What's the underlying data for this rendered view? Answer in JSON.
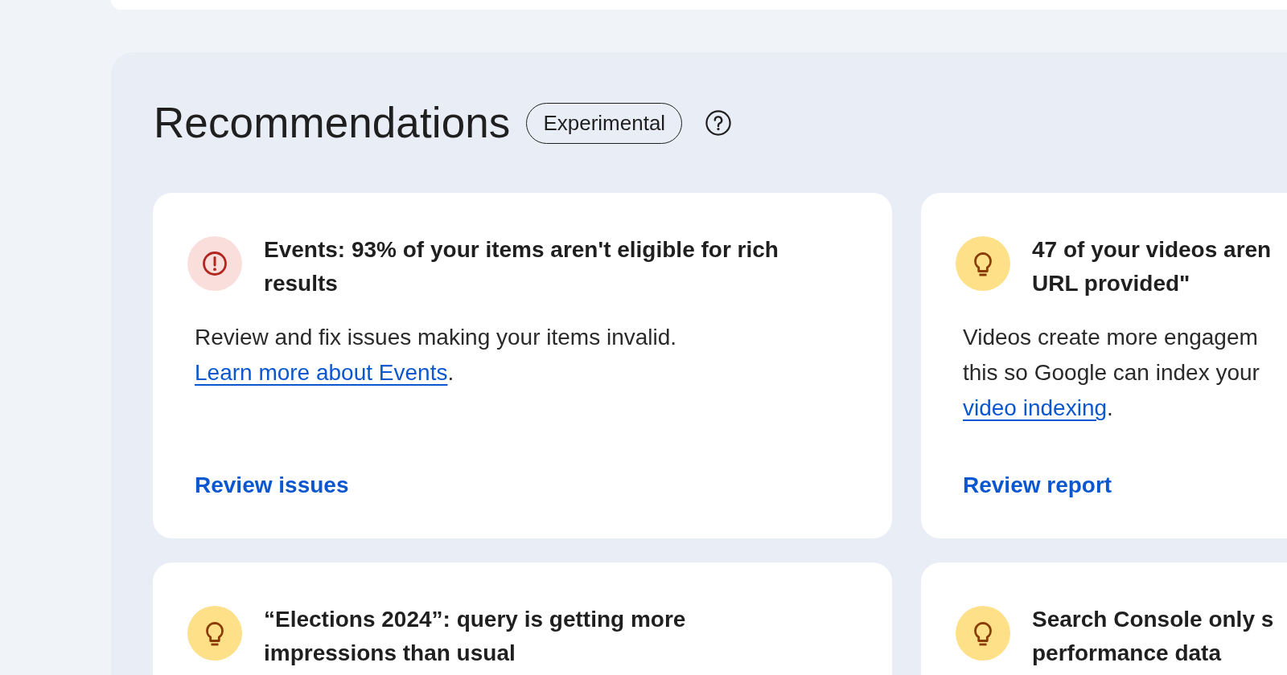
{
  "section": {
    "title": "Recommendations",
    "badge": "Experimental"
  },
  "cards": [
    {
      "kind": "error",
      "title_lines": [
        "Events: 93% of your items aren't eligible for rich",
        "results"
      ],
      "body": [
        {
          "kind": "text",
          "text": "Review and fix issues making your items invalid. "
        },
        {
          "kind": "link",
          "text": "Learn more about Events"
        },
        {
          "kind": "text",
          "text": "."
        }
      ],
      "action": "Review issues"
    },
    {
      "kind": "tip",
      "title_lines": [
        "47 of your videos aren",
        "URL provided\""
      ],
      "body": [
        {
          "kind": "text",
          "text": "Videos create more engagem\nthis so Google can index your\n"
        },
        {
          "kind": "link",
          "text": "video indexing"
        },
        {
          "kind": "text",
          "text": "."
        }
      ],
      "action": "Review report"
    },
    {
      "kind": "tip",
      "title_lines": [
        "“Elections 2024”: query is getting more",
        "impressions than usual"
      ]
    },
    {
      "kind": "tip",
      "title_lines": [
        "Search Console only s",
        "performance data"
      ]
    }
  ]
}
